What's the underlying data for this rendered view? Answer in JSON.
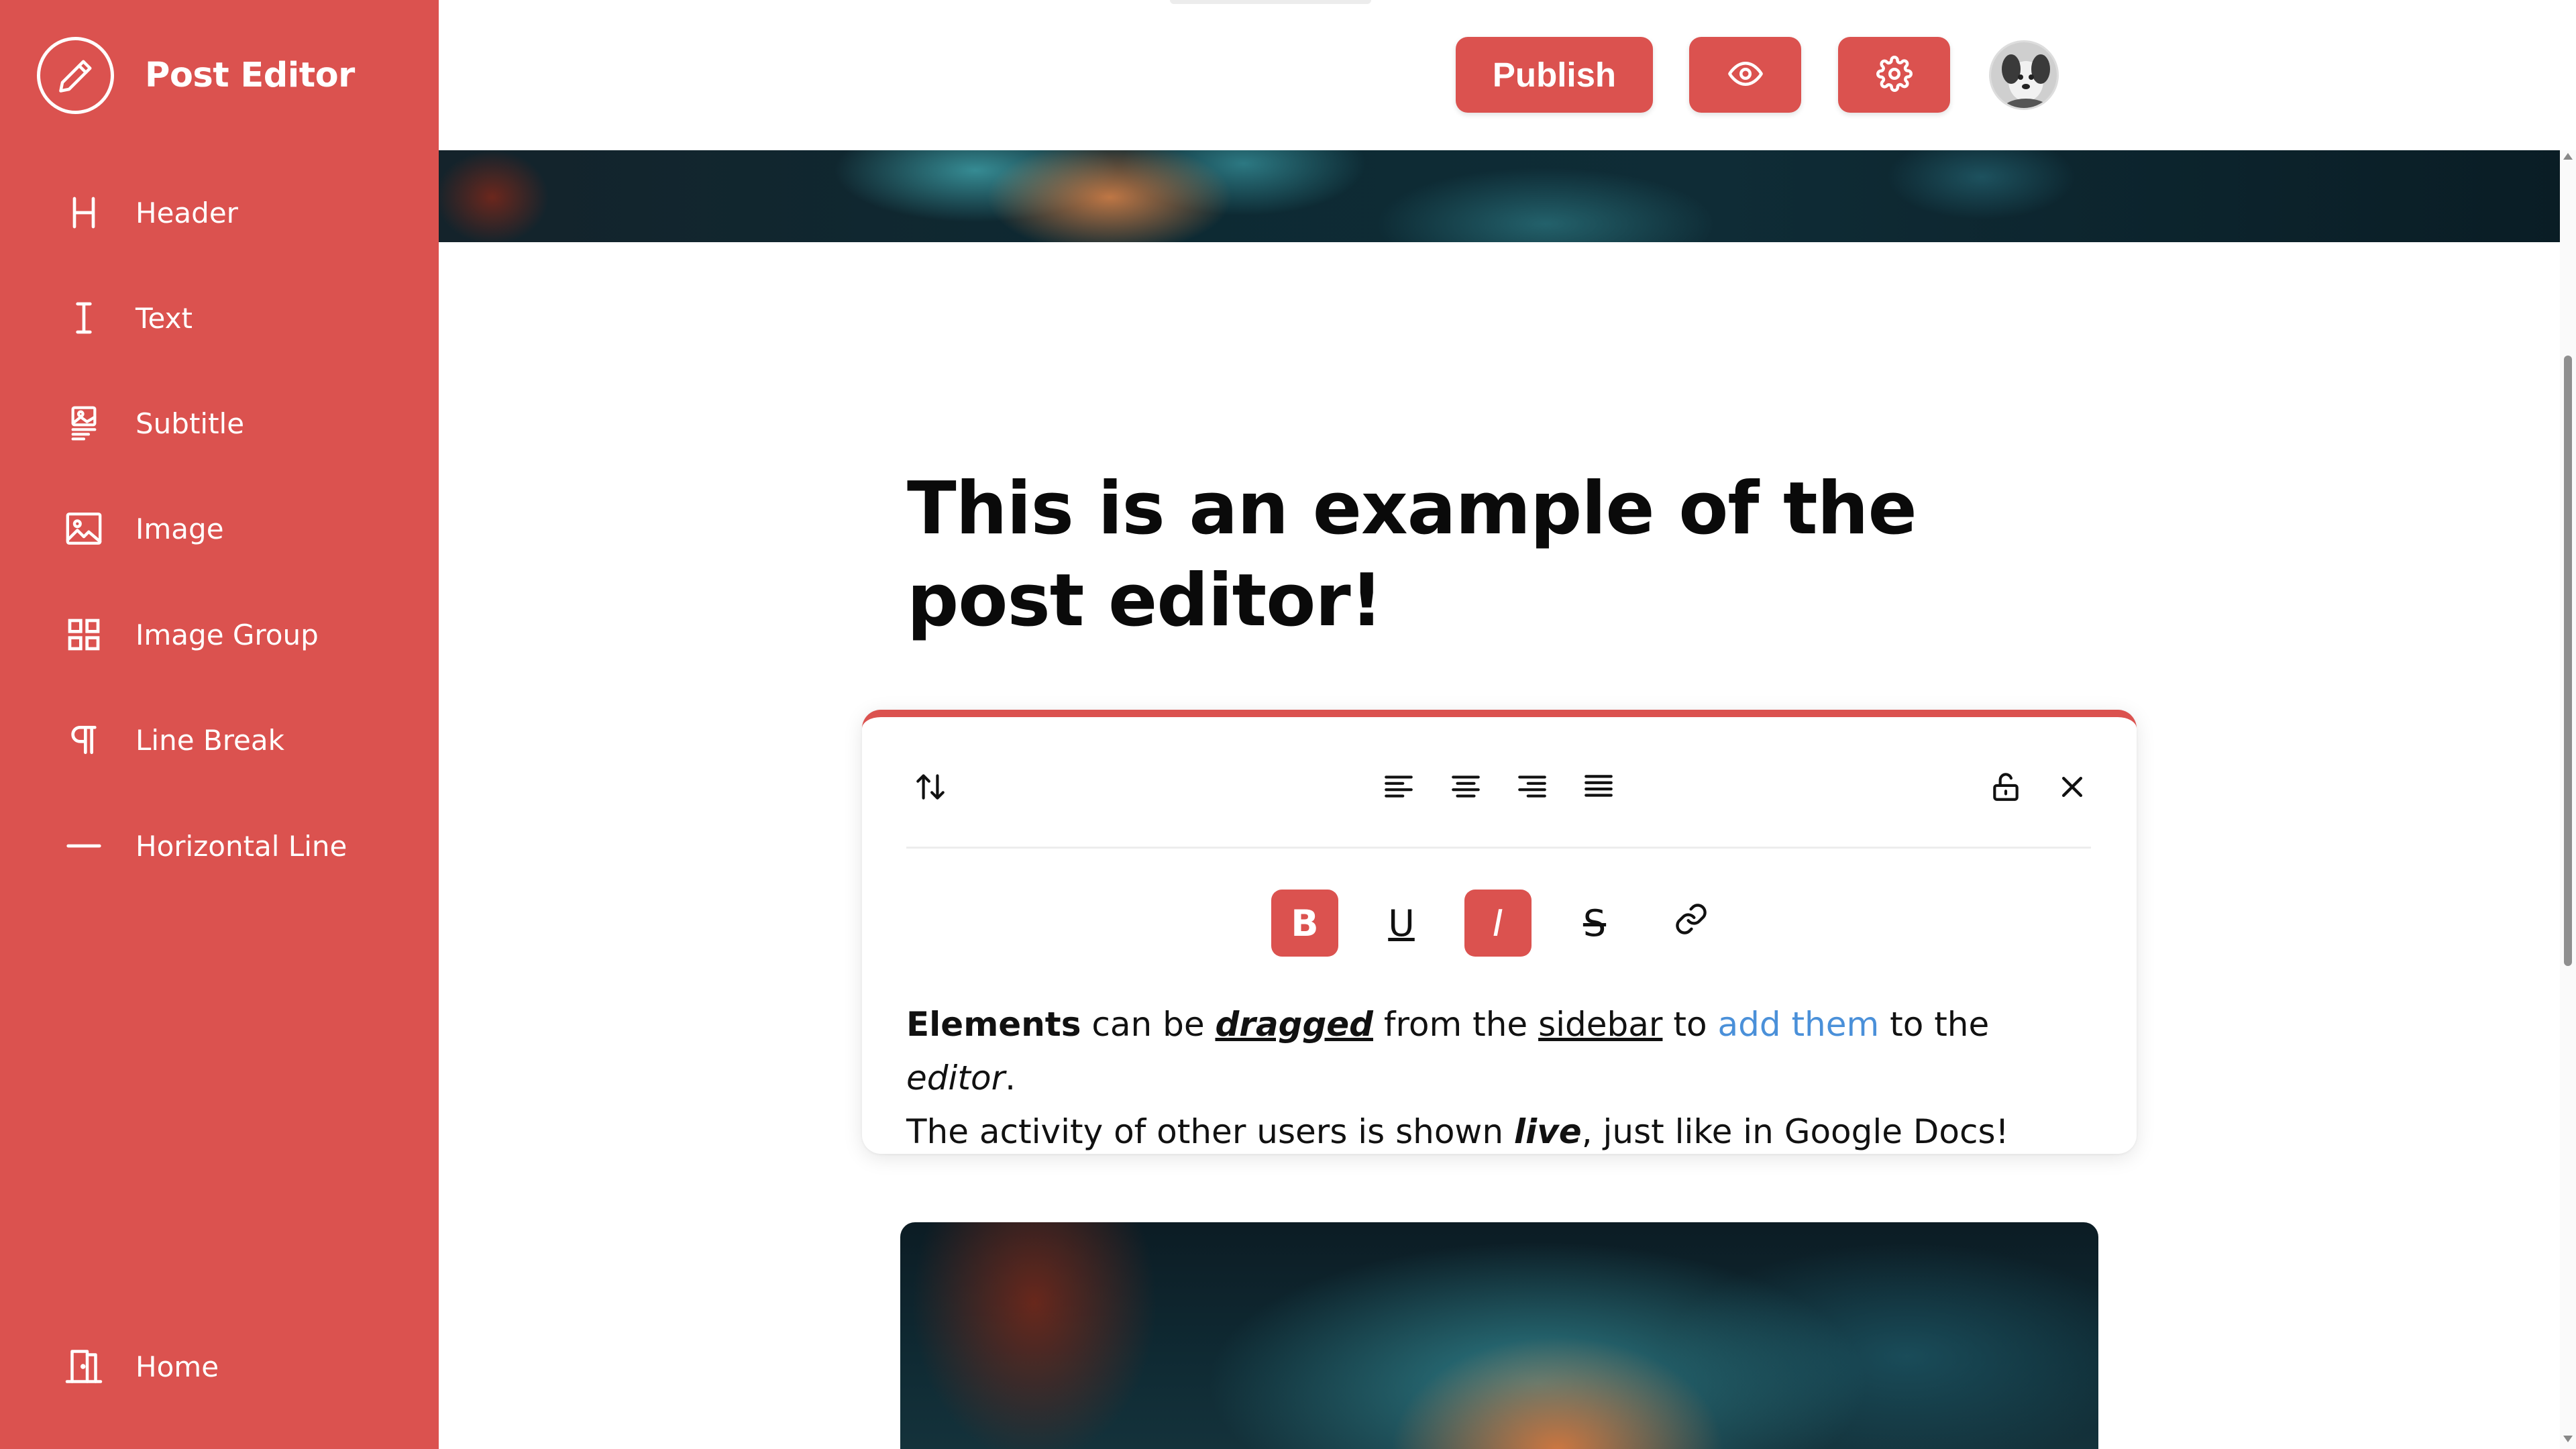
{
  "app": {
    "title": "Post Editor",
    "icon": "pencil-icon",
    "accent_color": "#db524f"
  },
  "sidebar": {
    "items": [
      {
        "label": "Header",
        "icon": "heading-icon"
      },
      {
        "label": "Text",
        "icon": "text-cursor-icon"
      },
      {
        "label": "Subtitle",
        "icon": "subtitle-icon"
      },
      {
        "label": "Image",
        "icon": "image-icon"
      },
      {
        "label": "Image Group",
        "icon": "grid-icon"
      },
      {
        "label": "Line Break",
        "icon": "pilcrow-icon"
      },
      {
        "label": "Horizontal Line",
        "icon": "horizontal-line-icon"
      }
    ],
    "footer_item": {
      "label": "Home",
      "icon": "door-icon"
    }
  },
  "topbar": {
    "publish_label": "Publish",
    "preview_icon": "eye-icon",
    "settings_icon": "gear-icon",
    "avatar_icon": "user-avatar"
  },
  "post": {
    "title": "This is an example of the post editor!"
  },
  "editor": {
    "toolbar_left_icon": "swap-vertical-icon",
    "align_icons": [
      "align-left-icon",
      "align-center-icon",
      "align-right-icon",
      "align-justify-icon"
    ],
    "toolbar_right_icons": [
      "unlock-icon",
      "close-icon"
    ],
    "format_buttons": [
      {
        "label": "B",
        "active": true
      },
      {
        "label": "U",
        "active": false
      },
      {
        "label": "I",
        "active": true
      },
      {
        "label": "S",
        "active": false
      },
      {
        "icon": "link-icon",
        "active": false
      }
    ],
    "body": {
      "s1": "Elements",
      "s2": " can be ",
      "s3": "dragged",
      "s4": " from the ",
      "s5": "sidebar",
      "s6": " to ",
      "s7": "add them",
      "s8": " to the ",
      "s9": "editor",
      "s10": ".",
      "s11": "The activity of other users is shown ",
      "s12": "live",
      "s13": ", just like in Google Docs!"
    }
  }
}
